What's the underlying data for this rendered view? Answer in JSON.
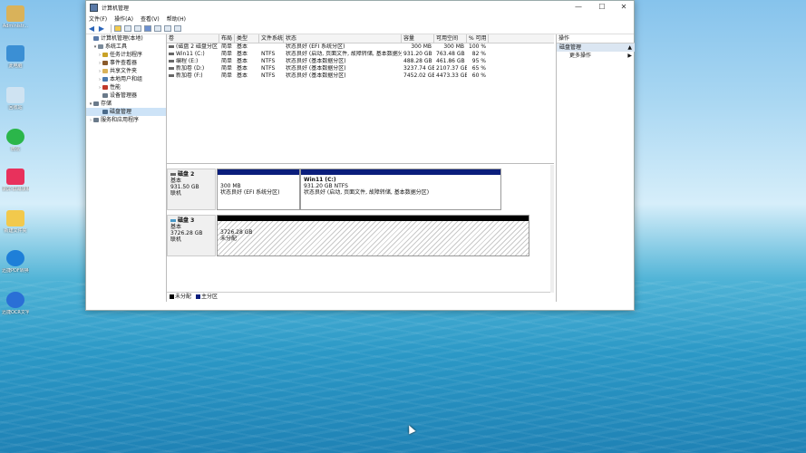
{
  "desktop": {
    "icons": [
      {
        "label": "Administr...",
        "icon": "user-folder-icon",
        "color": "#d9b25a"
      },
      {
        "label": "此电脑",
        "icon": "computer-icon",
        "color": "#3b8fd4"
      },
      {
        "label": "回收站",
        "icon": "recycle-bin-icon",
        "color": "#cfe3f2"
      },
      {
        "label": "微信",
        "icon": "wechat-icon",
        "color": "#2bb64a"
      },
      {
        "label": "录屏-屏幕录制",
        "icon": "screen-recorder-icon",
        "color": "#e8315c"
      },
      {
        "label": "新建文件夹",
        "icon": "folder-icon",
        "color": "#f2c94c"
      },
      {
        "label": "迅捷PDF转换器",
        "icon": "pdf-converter-icon",
        "color": "#1e7fd8"
      },
      {
        "label": "迅捷OCR文字识别",
        "icon": "ocr-icon",
        "color": "#2a6fd6"
      }
    ]
  },
  "window": {
    "title": "计算机管理",
    "controls": {
      "minimize": "—",
      "maximize": "☐",
      "close": "✕"
    },
    "menu": [
      "文件(F)",
      "操作(A)",
      "查看(V)",
      "帮助(H)"
    ]
  },
  "tree": [
    {
      "label": "计算机管理(本地)",
      "indent": 0,
      "toggle": "",
      "icon_color": "#5a7aa8"
    },
    {
      "label": "系统工具",
      "indent": 1,
      "toggle": "▾",
      "icon_color": "#7a8a9a"
    },
    {
      "label": "任务计划程序",
      "indent": 2,
      "toggle": "›",
      "icon_color": "#c9a227"
    },
    {
      "label": "事件查看器",
      "indent": 2,
      "toggle": "›",
      "icon_color": "#8a5a2a"
    },
    {
      "label": "共享文件夹",
      "indent": 2,
      "toggle": "›",
      "icon_color": "#d9b25a"
    },
    {
      "label": "本地用户和组",
      "indent": 2,
      "toggle": "›",
      "icon_color": "#4a7ab0"
    },
    {
      "label": "性能",
      "indent": 2,
      "toggle": "›",
      "icon_color": "#c0392b"
    },
    {
      "label": "设备管理器",
      "indent": 2,
      "toggle": "",
      "icon_color": "#6a7a8a"
    },
    {
      "label": "存储",
      "indent": 0,
      "toggle": "▾",
      "icon_color": "#6a7a8a"
    },
    {
      "label": "磁盘管理",
      "indent": 2,
      "toggle": "",
      "icon_color": "#4a6a8a",
      "selected": true
    },
    {
      "label": "服务和应用程序",
      "indent": 0,
      "toggle": "›",
      "icon_color": "#6a7a8a"
    }
  ],
  "volumes": {
    "headers": [
      "卷",
      "布局",
      "类型",
      "文件系统",
      "状态",
      "容量",
      "可用空间",
      "% 可用"
    ],
    "rows": [
      [
        "(磁盘 2 磁盘分区 1)",
        "简单",
        "基本",
        "",
        "状态良好 (EFI 系统分区)",
        "300 MB",
        "300 MB",
        "100 %"
      ],
      [
        "Win11 (C:)",
        "简单",
        "基本",
        "NTFS",
        "状态良好 (启动, 页面文件, 故障转储, 基本数据分区)",
        "931.20 GB",
        "763.48 GB",
        "82 %"
      ],
      [
        "编程 (E:)",
        "简单",
        "基本",
        "NTFS",
        "状态良好 (基本数据分区)",
        "488.28 GB",
        "461.86 GB",
        "95 %"
      ],
      [
        "新加卷 (D:)",
        "简单",
        "基本",
        "NTFS",
        "状态良好 (基本数据分区)",
        "3237.74 GB",
        "2107.37 GB",
        "65 %"
      ],
      [
        "新加卷 (F:)",
        "简单",
        "基本",
        "NTFS",
        "状态良好 (基本数据分区)",
        "7452.02 GB",
        "4473.33 GB",
        "60 %"
      ]
    ]
  },
  "disks": [
    {
      "name": "磁盘 2",
      "type": "基本",
      "size": "931.50 GB",
      "status": "联机",
      "partitions": [
        {
          "title": "",
          "lines": [
            "300 MB",
            "状态良好 (EFI 系统分区)"
          ],
          "bar": "primary"
        },
        {
          "title": "Win11 (C:)",
          "lines": [
            "931.20 GB NTFS",
            "状态良好 (启动, 页面文件, 故障转储, 基本数据分区)"
          ],
          "bar": "primary"
        }
      ]
    },
    {
      "name": "磁盘 3",
      "type": "基本",
      "size": "3726.28 GB",
      "status": "联机",
      "partitions": [
        {
          "title": "",
          "lines": [
            "3726.28 GB",
            "未分配"
          ],
          "bar": "unallocated"
        }
      ]
    }
  ],
  "legend": [
    {
      "label": "未分配",
      "color": "#000000"
    },
    {
      "label": "主分区",
      "color": "#0b1e7c"
    }
  ],
  "actions": {
    "title": "操作",
    "section": "磁盘管理",
    "items": [
      "更多操作"
    ]
  }
}
